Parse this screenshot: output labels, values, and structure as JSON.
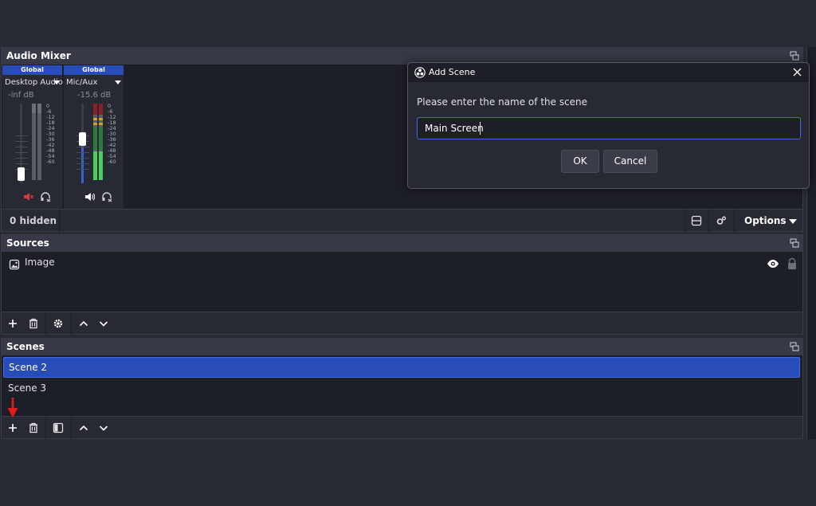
{
  "mixer": {
    "title": "Audio Mixer",
    "strips": [
      {
        "scope": "Global",
        "name": "Desktop Audio",
        "db": "-inf dB",
        "fader_level": 0.05,
        "muted": true
      },
      {
        "scope": "Global",
        "name": "Mic/Aux",
        "db": "-15.6 dB",
        "fader_level": 0.55,
        "muted": false
      }
    ],
    "scale": [
      "0",
      "-6",
      "-12",
      "-18",
      "-24",
      "-30",
      "-36",
      "-42",
      "-48",
      "-54",
      "-60"
    ],
    "hidden_label": "0 hidden",
    "options_label": "Options"
  },
  "sources": {
    "title": "Sources",
    "items": [
      {
        "name": "Image",
        "icon": "image-icon",
        "visible": true,
        "locked": false
      }
    ]
  },
  "scenes": {
    "title": "Scenes",
    "items": [
      {
        "name": "Scene 2",
        "selected": true
      },
      {
        "name": "Scene 3",
        "selected": false
      }
    ]
  },
  "dialog": {
    "title": "Add Scene",
    "prompt": "Please enter the name of the scene",
    "input_value": "Main Screen",
    "ok_label": "OK",
    "cancel_label": "Cancel"
  },
  "colors": {
    "accent": "#284cb8",
    "panel": "#1d1f27",
    "titlebar": "#373a46",
    "annotation_arrow": "#e21b1b"
  }
}
